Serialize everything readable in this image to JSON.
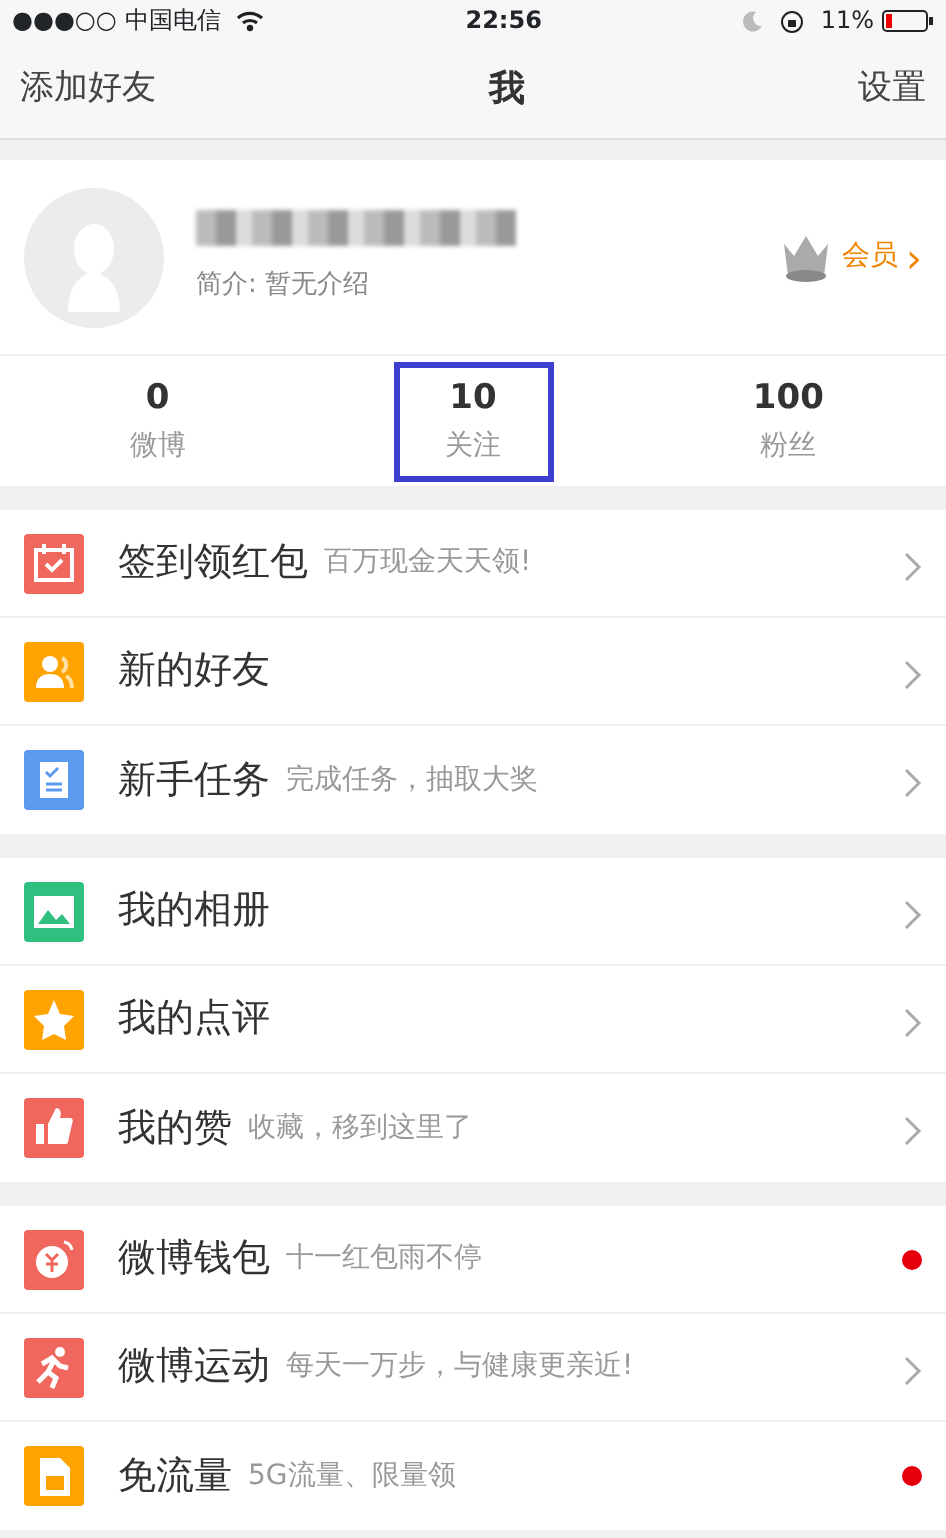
{
  "status_bar": {
    "signal": "●●●○○",
    "carrier": "中国电信",
    "time": "22:56",
    "battery": "11%"
  },
  "nav": {
    "left": "添加好友",
    "title": "我",
    "right": "设置"
  },
  "profile": {
    "bio": "简介: 暂无介绍",
    "member": "会员",
    "member_arrow": "›"
  },
  "stats": [
    {
      "value": "0",
      "label": "微博",
      "highlighted": false
    },
    {
      "value": "10",
      "label": "关注",
      "highlighted": true
    },
    {
      "value": "100",
      "label": "粉丝",
      "highlighted": false
    }
  ],
  "groups": [
    {
      "items": [
        {
          "color": "#f0685d",
          "title": "签到领红包",
          "subtitle": "百万现金天天领!",
          "kind": "chevron"
        },
        {
          "color": "#ffa300",
          "title": "新的好友",
          "kind": "chevron"
        },
        {
          "color": "#5a9bf0",
          "title": "新手任务",
          "subtitle": "完成任务，抽取大奖",
          "kind": "chevron"
        }
      ]
    },
    {
      "items": [
        {
          "color": "#2fbf7f",
          "title": "我的相册",
          "kind": "chevron"
        },
        {
          "color": "#ffa300",
          "title": "我的点评",
          "kind": "chevron"
        },
        {
          "color": "#f0685d",
          "title": "我的赞",
          "subtitle": "收藏，移到这里了",
          "kind": "chevron"
        }
      ]
    },
    {
      "items": [
        {
          "color": "#f0685d",
          "title": "微博钱包",
          "subtitle": "十一红包雨不停",
          "kind": "dot"
        },
        {
          "color": "#f0685d",
          "title": "微博运动",
          "subtitle": "每天一万步，与健康更亲近!",
          "kind": "chevron"
        },
        {
          "color": "#ffa300",
          "title": "免流量",
          "subtitle": "5G流量、限量领",
          "kind": "dot"
        }
      ]
    }
  ]
}
